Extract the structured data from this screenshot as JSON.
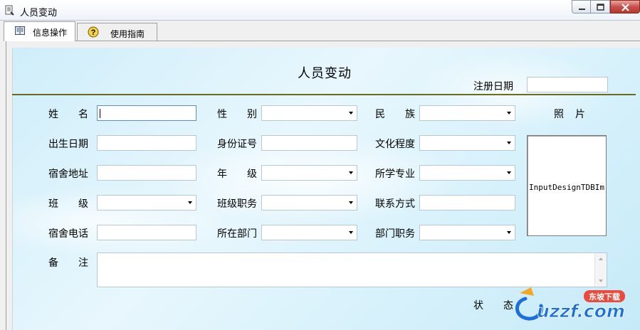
{
  "window": {
    "title": "人员变动"
  },
  "tabs": [
    {
      "label": "信息操作",
      "icon": "book-icon",
      "active": true
    },
    {
      "label": "使用指南",
      "icon": "help-icon",
      "active": false
    }
  ],
  "form": {
    "title": "人员变动",
    "register_date_label": "注册日期",
    "register_date_value": "",
    "labels": {
      "name": "姓名",
      "gender": "性别",
      "ethnicity": "民族",
      "photo": "照片",
      "birth_date": "出生日期",
      "id_number": "身份证号",
      "education": "文化程度",
      "dorm_address": "宿舍地址",
      "grade": "年级",
      "major": "所学专业",
      "class": "班级",
      "class_position": "班级职务",
      "contact": "联系方式",
      "dorm_phone": "宿舍电话",
      "department": "所在部门",
      "dept_position": "部门职务",
      "remarks": "备注",
      "status": "状态"
    },
    "photo_placeholder": "InputDesignTDBIm"
  },
  "watermark": {
    "text": "uzzf.com",
    "badge": "东坡下载"
  },
  "colors": {
    "accent_line": "#6b6b1c",
    "panel": "#d6f1fb",
    "watermark_blue": "#1e6fd9"
  }
}
